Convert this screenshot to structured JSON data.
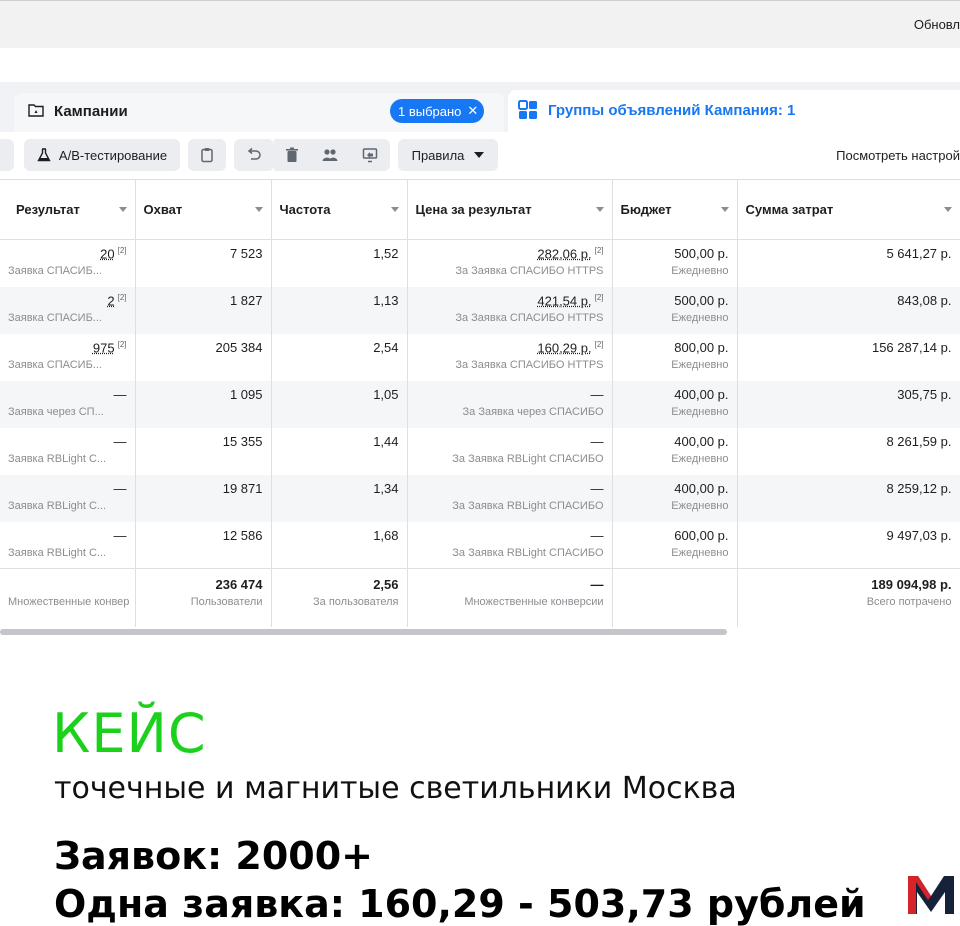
{
  "topbar": {
    "right_text": "Обновл"
  },
  "tabs": {
    "campaigns_label": "Кампании",
    "selected_chip": "1 выбрано",
    "adsets_label": "Группы объявлений Кампания: 1"
  },
  "toolbar": {
    "ab_test_label": "A/B-тестирование",
    "rules_label": "Правила",
    "view_settings_label": "Посмотреть настрой"
  },
  "table": {
    "columns": [
      "Результат",
      "Охват",
      "Частота",
      "Цена за результат",
      "Бюджет",
      "Сумма затрат"
    ],
    "rows": [
      {
        "result": "20",
        "result_sub": "Заявка СПАСИБ...",
        "reach": "7 523",
        "freq": "1,52",
        "cost": "282,06 р.",
        "cost_sub": "За Заявка СПАСИБО HTTPS",
        "budget": "500,00 р.",
        "budget_sub": "Ежедневно",
        "spend": "5 641,27 р."
      },
      {
        "result": "2",
        "result_sub": "Заявка СПАСИБ...",
        "reach": "1 827",
        "freq": "1,13",
        "cost": "421,54 р.",
        "cost_sub": "За Заявка СПАСИБО HTTPS",
        "budget": "500,00 р.",
        "budget_sub": "Ежедневно",
        "spend": "843,08 р."
      },
      {
        "result": "975",
        "result_sub": "Заявка СПАСИБ...",
        "reach": "205 384",
        "freq": "2,54",
        "cost": "160,29 р.",
        "cost_sub": "За Заявка СПАСИБО HTTPS",
        "budget": "800,00 р.",
        "budget_sub": "Ежедневно",
        "spend": "156 287,14 р."
      },
      {
        "result": "—",
        "result_sub": "Заявка через СП...",
        "reach": "1 095",
        "freq": "1,05",
        "cost": "—",
        "cost_sub": "За Заявка через СПАСИБО",
        "budget": "400,00 р.",
        "budget_sub": "Ежедневно",
        "spend": "305,75 р."
      },
      {
        "result": "—",
        "result_sub": "Заявка RBLight C...",
        "reach": "15 355",
        "freq": "1,44",
        "cost": "—",
        "cost_sub": "За Заявка RBLight СПАСИБО",
        "budget": "400,00 р.",
        "budget_sub": "Ежедневно",
        "spend": "8 261,59 р."
      },
      {
        "result": "—",
        "result_sub": "Заявка RBLight C...",
        "reach": "19 871",
        "freq": "1,34",
        "cost": "—",
        "cost_sub": "За Заявка RBLight СПАСИБО",
        "budget": "400,00 р.",
        "budget_sub": "Ежедневно",
        "spend": "8 259,12 р."
      },
      {
        "result": "—",
        "result_sub": "Заявка RBLight C...",
        "reach": "12 586",
        "freq": "1,68",
        "cost": "—",
        "cost_sub": "За Заявка RBLight СПАСИБО",
        "budget": "600,00 р.",
        "budget_sub": "Ежедневно",
        "spend": "9 497,03 р."
      }
    ],
    "totals": {
      "result_sub": "Множественные конвер",
      "reach": "236 474",
      "reach_sub": "Пользователи",
      "freq": "2,56",
      "freq_sub": "За пользователя",
      "cost": "—",
      "cost_sub": "Множественные конверсии",
      "spend": "189 094,98 р.",
      "spend_sub": "Всего потрачено"
    }
  },
  "overlay": {
    "headline": "КЕЙС",
    "subtitle": "точечные и магнитые светильники Москва",
    "stat_requests": "Заявок: 2000+",
    "stat_cost": "Одна заявка: 160,29 - 503,73 рублей",
    "logo_text": "M"
  },
  "colors": {
    "accent_blue": "#1877f2",
    "headline_green": "#1cd11c"
  }
}
